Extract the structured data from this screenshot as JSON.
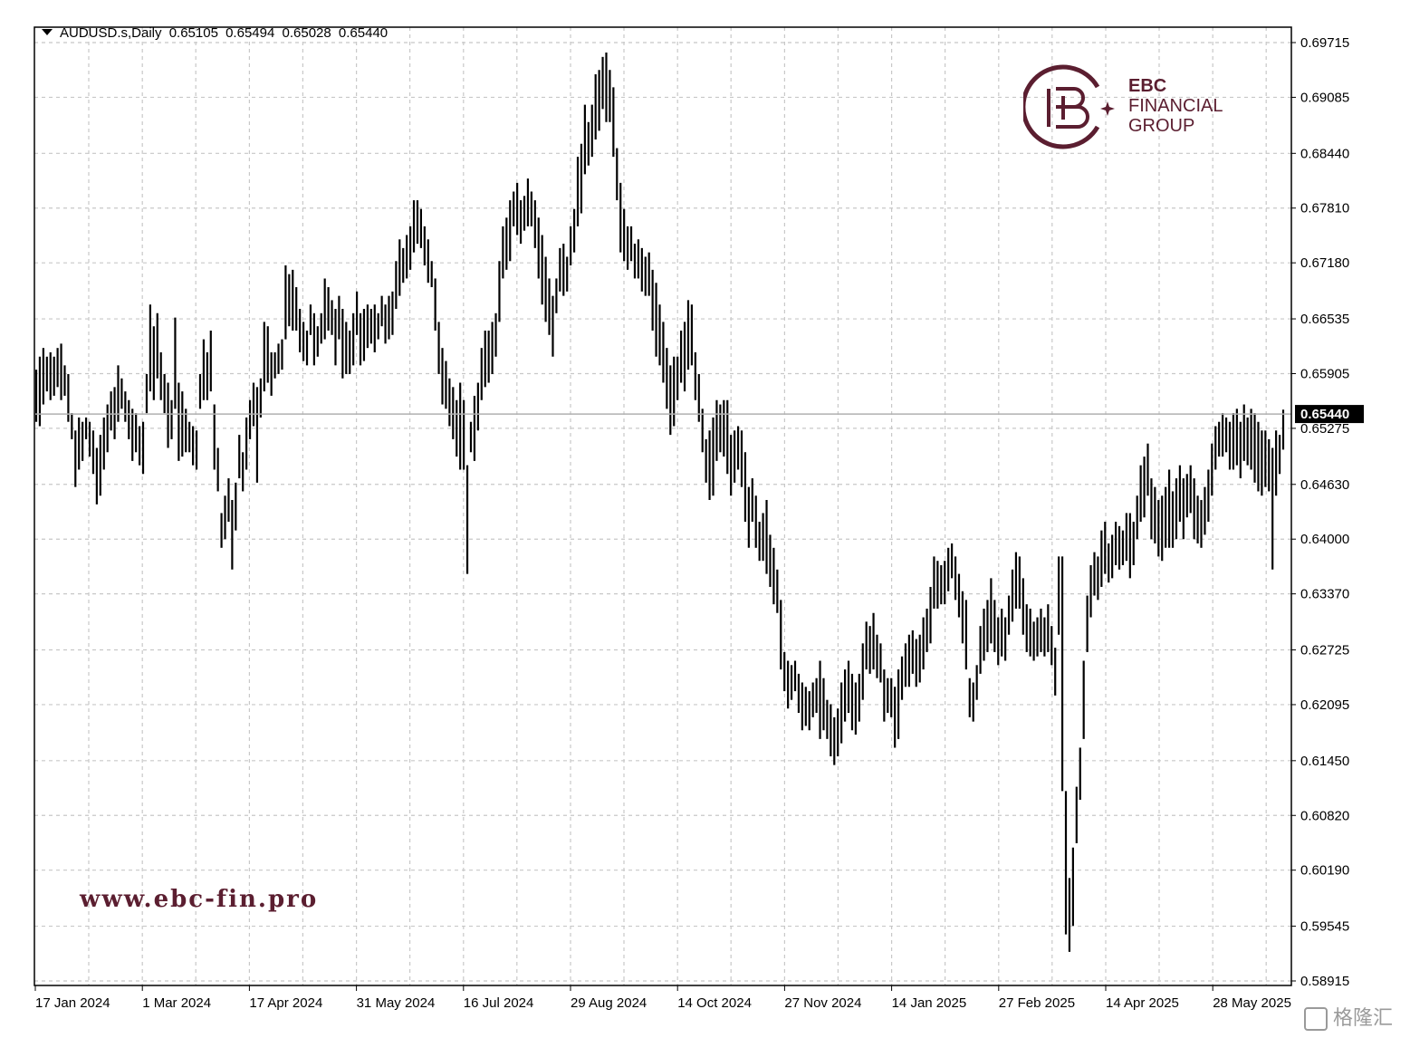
{
  "header": {
    "symbol": "AUDUSD.s,Daily",
    "open": "0.65105",
    "high": "0.65494",
    "low": "0.65028",
    "close": "0.65440"
  },
  "watermark": {
    "url": "www.ebc-fin.pro",
    "brand_line1": "EBC",
    "brand_line2": "FINANCIAL",
    "brand_line3": "GROUP"
  },
  "footer_badge": "格隆汇",
  "colors": {
    "bars": "#000000",
    "grid": "#c8c8c8",
    "brand": "#5b1e30",
    "price_line": "#b0b0b0"
  },
  "chart_data": {
    "type": "ohlc",
    "grid": true,
    "current_price": 0.6544,
    "current_price_label": "0.65440",
    "y_ticks": [
      "0.69715",
      "0.69085",
      "0.68440",
      "0.67810",
      "0.67180",
      "0.66535",
      "0.65905",
      "0.65275",
      "0.64630",
      "0.64000",
      "0.63370",
      "0.62725",
      "0.62095",
      "0.61450",
      "0.60820",
      "0.60190",
      "0.59545",
      "0.58915"
    ],
    "x_ticks": [
      "17 Jan 2024",
      "1 Mar 2024",
      "17 Apr 2024",
      "31 May 2024",
      "16 Jul 2024",
      "29 Aug 2024",
      "14 Oct 2024",
      "27 Nov 2024",
      "14 Jan 2025",
      "27 Feb 2025",
      "14 Apr 2025",
      "28 May 2025"
    ],
    "ylim": [
      0.58915,
      0.69715
    ],
    "bars": [
      [
        0.6595,
        0.6535
      ],
      [
        0.661,
        0.653
      ],
      [
        0.662,
        0.6555
      ],
      [
        0.661,
        0.657
      ],
      [
        0.6615,
        0.656
      ],
      [
        0.661,
        0.6565
      ],
      [
        0.662,
        0.6575
      ],
      [
        0.6625,
        0.656
      ],
      [
        0.66,
        0.6565
      ],
      [
        0.659,
        0.6535
      ],
      [
        0.6545,
        0.6515
      ],
      [
        0.6525,
        0.646
      ],
      [
        0.654,
        0.648
      ],
      [
        0.6535,
        0.649
      ],
      [
        0.654,
        0.6515
      ],
      [
        0.6535,
        0.6495
      ],
      [
        0.6525,
        0.6475
      ],
      [
        0.6505,
        0.644
      ],
      [
        0.652,
        0.645
      ],
      [
        0.654,
        0.648
      ],
      [
        0.6555,
        0.65
      ],
      [
        0.657,
        0.6525
      ],
      [
        0.6575,
        0.6515
      ],
      [
        0.66,
        0.6535
      ],
      [
        0.6585,
        0.655
      ],
      [
        0.657,
        0.6535
      ],
      [
        0.656,
        0.6515
      ],
      [
        0.655,
        0.649
      ],
      [
        0.6545,
        0.65
      ],
      [
        0.653,
        0.6485
      ],
      [
        0.6535,
        0.6475
      ],
      [
        0.659,
        0.6545
      ],
      [
        0.667,
        0.657
      ],
      [
        0.6645,
        0.656
      ],
      [
        0.666,
        0.6585
      ],
      [
        0.6615,
        0.656
      ],
      [
        0.659,
        0.6545
      ],
      [
        0.658,
        0.6505
      ],
      [
        0.656,
        0.6515
      ],
      [
        0.6655,
        0.655
      ],
      [
        0.658,
        0.649
      ],
      [
        0.657,
        0.6495
      ],
      [
        0.655,
        0.65
      ],
      [
        0.6535,
        0.65
      ],
      [
        0.653,
        0.6485
      ],
      [
        0.6525,
        0.648
      ],
      [
        0.659,
        0.655
      ],
      [
        0.663,
        0.656
      ],
      [
        0.6615,
        0.656
      ],
      [
        0.664,
        0.657
      ],
      [
        0.6555,
        0.648
      ],
      [
        0.6505,
        0.6455
      ],
      [
        0.643,
        0.639
      ],
      [
        0.645,
        0.64
      ],
      [
        0.647,
        0.642
      ],
      [
        0.6445,
        0.6365
      ],
      [
        0.6465,
        0.641
      ],
      [
        0.652,
        0.647
      ],
      [
        0.65,
        0.6455
      ],
      [
        0.654,
        0.648
      ],
      [
        0.656,
        0.6515
      ],
      [
        0.658,
        0.653
      ],
      [
        0.6575,
        0.6465
      ],
      [
        0.6585,
        0.654
      ],
      [
        0.665,
        0.657
      ],
      [
        0.6645,
        0.658
      ],
      [
        0.6615,
        0.6565
      ],
      [
        0.6615,
        0.6585
      ],
      [
        0.6625,
        0.659
      ],
      [
        0.663,
        0.6595
      ],
      [
        0.6715,
        0.663
      ],
      [
        0.6705,
        0.6645
      ],
      [
        0.671,
        0.664
      ],
      [
        0.669,
        0.664
      ],
      [
        0.6665,
        0.6615
      ],
      [
        0.665,
        0.6605
      ],
      [
        0.664,
        0.66
      ],
      [
        0.667,
        0.6635
      ],
      [
        0.666,
        0.66
      ],
      [
        0.6645,
        0.661
      ],
      [
        0.666,
        0.6625
      ],
      [
        0.67,
        0.663
      ],
      [
        0.669,
        0.664
      ],
      [
        0.6675,
        0.6635
      ],
      [
        0.6665,
        0.66
      ],
      [
        0.668,
        0.663
      ],
      [
        0.6665,
        0.6585
      ],
      [
        0.665,
        0.659
      ],
      [
        0.664,
        0.659
      ],
      [
        0.666,
        0.66
      ],
      [
        0.6685,
        0.6635
      ],
      [
        0.666,
        0.66
      ],
      [
        0.6665,
        0.6605
      ],
      [
        0.667,
        0.662
      ],
      [
        0.6665,
        0.6625
      ],
      [
        0.667,
        0.6615
      ],
      [
        0.666,
        0.663
      ],
      [
        0.668,
        0.6645
      ],
      [
        0.667,
        0.6625
      ],
      [
        0.668,
        0.663
      ],
      [
        0.6685,
        0.6635
      ],
      [
        0.672,
        0.6665
      ],
      [
        0.6745,
        0.668
      ],
      [
        0.6735,
        0.6695
      ],
      [
        0.675,
        0.67
      ],
      [
        0.676,
        0.671
      ],
      [
        0.679,
        0.673
      ],
      [
        0.679,
        0.674
      ],
      [
        0.678,
        0.6735
      ],
      [
        0.676,
        0.6715
      ],
      [
        0.6745,
        0.6695
      ],
      [
        0.672,
        0.669
      ],
      [
        0.67,
        0.664
      ],
      [
        0.665,
        0.659
      ],
      [
        0.662,
        0.6555
      ],
      [
        0.6605,
        0.655
      ],
      [
        0.6585,
        0.653
      ],
      [
        0.6575,
        0.6515
      ],
      [
        0.656,
        0.6495
      ],
      [
        0.658,
        0.648
      ],
      [
        0.656,
        0.648
      ],
      [
        0.6485,
        0.636
      ],
      [
        0.6535,
        0.65
      ],
      [
        0.6565,
        0.649
      ],
      [
        0.658,
        0.6525
      ],
      [
        0.662,
        0.656
      ],
      [
        0.664,
        0.6575
      ],
      [
        0.664,
        0.658
      ],
      [
        0.665,
        0.659
      ],
      [
        0.666,
        0.661
      ],
      [
        0.672,
        0.665
      ],
      [
        0.676,
        0.67
      ],
      [
        0.677,
        0.671
      ],
      [
        0.679,
        0.672
      ],
      [
        0.68,
        0.676
      ],
      [
        0.681,
        0.675
      ],
      [
        0.679,
        0.674
      ],
      [
        0.6795,
        0.6755
      ],
      [
        0.6815,
        0.676
      ],
      [
        0.68,
        0.676
      ],
      [
        0.679,
        0.6735
      ],
      [
        0.677,
        0.67
      ],
      [
        0.675,
        0.667
      ],
      [
        0.6725,
        0.665
      ],
      [
        0.67,
        0.6635
      ],
      [
        0.668,
        0.661
      ],
      [
        0.67,
        0.666
      ],
      [
        0.6735,
        0.6685
      ],
      [
        0.674,
        0.668
      ],
      [
        0.6725,
        0.6685
      ],
      [
        0.676,
        0.6715
      ],
      [
        0.678,
        0.673
      ],
      [
        0.684,
        0.676
      ],
      [
        0.6855,
        0.6775
      ],
      [
        0.69,
        0.682
      ],
      [
        0.688,
        0.683
      ],
      [
        0.69,
        0.684
      ],
      [
        0.6935,
        0.686
      ],
      [
        0.694,
        0.687
      ],
      [
        0.6955,
        0.6895
      ],
      [
        0.696,
        0.688
      ],
      [
        0.694,
        0.688
      ],
      [
        0.692,
        0.684
      ],
      [
        0.685,
        0.679
      ],
      [
        0.681,
        0.673
      ],
      [
        0.678,
        0.672
      ],
      [
        0.676,
        0.671
      ],
      [
        0.676,
        0.672
      ],
      [
        0.674,
        0.67
      ],
      [
        0.6745,
        0.67
      ],
      [
        0.6735,
        0.6685
      ],
      [
        0.6725,
        0.668
      ],
      [
        0.673,
        0.668
      ],
      [
        0.671,
        0.664
      ],
      [
        0.6695,
        0.661
      ],
      [
        0.667,
        0.66
      ],
      [
        0.665,
        0.658
      ],
      [
        0.662,
        0.655
      ],
      [
        0.66,
        0.652
      ],
      [
        0.661,
        0.653
      ],
      [
        0.661,
        0.656
      ],
      [
        0.664,
        0.658
      ],
      [
        0.665,
        0.657
      ],
      [
        0.6675,
        0.6595
      ],
      [
        0.667,
        0.66
      ],
      [
        0.6615,
        0.656
      ],
      [
        0.659,
        0.6535
      ],
      [
        0.655,
        0.65
      ],
      [
        0.6515,
        0.6465
      ],
      [
        0.6525,
        0.6445
      ],
      [
        0.654,
        0.645
      ],
      [
        0.656,
        0.649
      ],
      [
        0.6555,
        0.65
      ],
      [
        0.656,
        0.6495
      ],
      [
        0.656,
        0.6475
      ],
      [
        0.652,
        0.645
      ],
      [
        0.6525,
        0.6465
      ],
      [
        0.653,
        0.648
      ],
      [
        0.6525,
        0.646
      ],
      [
        0.65,
        0.642
      ],
      [
        0.646,
        0.639
      ],
      [
        0.647,
        0.642
      ],
      [
        0.645,
        0.639
      ],
      [
        0.642,
        0.6375
      ],
      [
        0.643,
        0.6375
      ],
      [
        0.6445,
        0.636
      ],
      [
        0.6405,
        0.6345
      ],
      [
        0.639,
        0.6325
      ],
      [
        0.6365,
        0.6315
      ],
      [
        0.633,
        0.625
      ],
      [
        0.627,
        0.6225
      ],
      [
        0.626,
        0.6205
      ],
      [
        0.6255,
        0.6215
      ],
      [
        0.626,
        0.6225
      ],
      [
        0.6245,
        0.62
      ],
      [
        0.6235,
        0.618
      ],
      [
        0.623,
        0.6185
      ],
      [
        0.6225,
        0.618
      ],
      [
        0.6235,
        0.6195
      ],
      [
        0.624,
        0.62
      ],
      [
        0.626,
        0.617
      ],
      [
        0.624,
        0.618
      ],
      [
        0.6215,
        0.617
      ],
      [
        0.621,
        0.615
      ],
      [
        0.6195,
        0.614
      ],
      [
        0.6205,
        0.615
      ],
      [
        0.6235,
        0.6165
      ],
      [
        0.625,
        0.619
      ],
      [
        0.626,
        0.62
      ],
      [
        0.6245,
        0.618
      ],
      [
        0.6235,
        0.6175
      ],
      [
        0.6245,
        0.619
      ],
      [
        0.628,
        0.6215
      ],
      [
        0.6305,
        0.625
      ],
      [
        0.63,
        0.6245
      ],
      [
        0.6315,
        0.625
      ],
      [
        0.629,
        0.624
      ],
      [
        0.628,
        0.6235
      ],
      [
        0.625,
        0.619
      ],
      [
        0.624,
        0.62
      ],
      [
        0.624,
        0.6195
      ],
      [
        0.623,
        0.616
      ],
      [
        0.625,
        0.617
      ],
      [
        0.6265,
        0.6215
      ],
      [
        0.628,
        0.623
      ],
      [
        0.629,
        0.623
      ],
      [
        0.6295,
        0.6245
      ],
      [
        0.6285,
        0.623
      ],
      [
        0.629,
        0.6235
      ],
      [
        0.631,
        0.625
      ],
      [
        0.632,
        0.627
      ],
      [
        0.6345,
        0.628
      ],
      [
        0.638,
        0.632
      ],
      [
        0.6375,
        0.632
      ],
      [
        0.637,
        0.6325
      ],
      [
        0.6375,
        0.6325
      ],
      [
        0.639,
        0.634
      ],
      [
        0.6395,
        0.6355
      ],
      [
        0.638,
        0.633
      ],
      [
        0.636,
        0.631
      ],
      [
        0.634,
        0.628
      ],
      [
        0.633,
        0.625
      ],
      [
        0.624,
        0.6195
      ],
      [
        0.6235,
        0.619
      ],
      [
        0.6255,
        0.6215
      ],
      [
        0.63,
        0.6245
      ],
      [
        0.632,
        0.626
      ],
      [
        0.633,
        0.627
      ],
      [
        0.6355,
        0.628
      ],
      [
        0.633,
        0.627
      ],
      [
        0.631,
        0.6255
      ],
      [
        0.632,
        0.6265
      ],
      [
        0.631,
        0.626
      ],
      [
        0.6335,
        0.629
      ],
      [
        0.6365,
        0.6305
      ],
      [
        0.6385,
        0.632
      ],
      [
        0.638,
        0.632
      ],
      [
        0.6355,
        0.629
      ],
      [
        0.6325,
        0.627
      ],
      [
        0.632,
        0.6265
      ],
      [
        0.6305,
        0.626
      ],
      [
        0.631,
        0.6265
      ],
      [
        0.632,
        0.627
      ],
      [
        0.631,
        0.6265
      ],
      [
        0.6325,
        0.627
      ],
      [
        0.63,
        0.6255
      ],
      [
        0.6275,
        0.622
      ],
      [
        0.638,
        0.629
      ],
      [
        0.638,
        0.611
      ],
      [
        0.611,
        0.5945
      ],
      [
        0.601,
        0.5925
      ],
      [
        0.6045,
        0.5955
      ],
      [
        0.6115,
        0.605
      ],
      [
        0.616,
        0.61
      ],
      [
        0.626,
        0.617
      ],
      [
        0.6335,
        0.627
      ],
      [
        0.637,
        0.631
      ],
      [
        0.6385,
        0.6335
      ],
      [
        0.638,
        0.633
      ],
      [
        0.641,
        0.6345
      ],
      [
        0.642,
        0.636
      ],
      [
        0.6395,
        0.635
      ],
      [
        0.6405,
        0.6355
      ],
      [
        0.642,
        0.637
      ],
      [
        0.6415,
        0.6365
      ],
      [
        0.641,
        0.637
      ],
      [
        0.643,
        0.6375
      ],
      [
        0.643,
        0.6355
      ],
      [
        0.642,
        0.637
      ],
      [
        0.645,
        0.64
      ],
      [
        0.6485,
        0.642
      ],
      [
        0.6495,
        0.6425
      ],
      [
        0.651,
        0.645
      ],
      [
        0.647,
        0.64
      ],
      [
        0.646,
        0.6395
      ],
      [
        0.6445,
        0.638
      ],
      [
        0.645,
        0.6375
      ],
      [
        0.646,
        0.639
      ],
      [
        0.648,
        0.639
      ],
      [
        0.6455,
        0.639
      ],
      [
        0.647,
        0.64
      ],
      [
        0.6485,
        0.642
      ],
      [
        0.647,
        0.64
      ],
      [
        0.6475,
        0.6425
      ],
      [
        0.6485,
        0.643
      ],
      [
        0.647,
        0.64
      ],
      [
        0.645,
        0.6395
      ],
      [
        0.6445,
        0.639
      ],
      [
        0.646,
        0.6405
      ],
      [
        0.648,
        0.642
      ],
      [
        0.651,
        0.645
      ],
      [
        0.653,
        0.648
      ],
      [
        0.6535,
        0.6495
      ],
      [
        0.6545,
        0.6495
      ],
      [
        0.654,
        0.65
      ],
      [
        0.6535,
        0.648
      ],
      [
        0.6545,
        0.648
      ],
      [
        0.655,
        0.6485
      ],
      [
        0.6535,
        0.647
      ],
      [
        0.6555,
        0.649
      ],
      [
        0.654,
        0.6485
      ],
      [
        0.655,
        0.648
      ],
      [
        0.6545,
        0.6465
      ],
      [
        0.6535,
        0.6455
      ],
      [
        0.6525,
        0.645
      ],
      [
        0.6525,
        0.646
      ],
      [
        0.6515,
        0.6455
      ],
      [
        0.6505,
        0.6365
      ],
      [
        0.6525,
        0.645
      ],
      [
        0.652,
        0.6475
      ],
      [
        0.6549,
        0.6503
      ]
    ]
  }
}
